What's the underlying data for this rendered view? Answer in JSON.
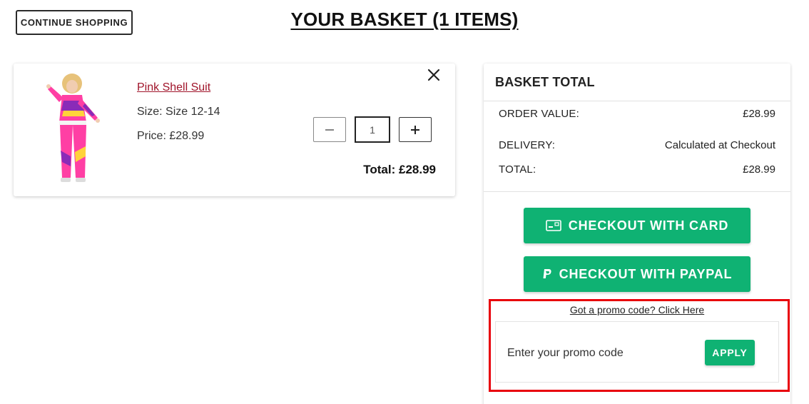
{
  "header": {
    "continue_label": "CONTINUE SHOPPING",
    "title": "YOUR BASKET (1 ITEMS)"
  },
  "item": {
    "name": "Pink Shell Suit",
    "size": "Size: Size 12-14",
    "price": "Price: £28.99",
    "quantity": "1",
    "total": "Total: £28.99",
    "image_icon": "product-photo",
    "remove_icon": "close-icon"
  },
  "summary": {
    "title": "BASKET TOTAL",
    "rows": [
      {
        "label": "ORDER VALUE:",
        "value": "£28.99"
      },
      {
        "label": "DELIVERY:",
        "value": "Calculated at Checkout"
      },
      {
        "label": "TOTAL:",
        "value": "£28.99"
      }
    ],
    "checkout_card_label": "CHECKOUT WITH CARD",
    "checkout_paypal_label": "CHECKOUT WITH PAYPAL"
  },
  "promo": {
    "link_text": "Got a promo code? Click Here",
    "placeholder": "Enter your promo code",
    "apply_label": "APPLY"
  },
  "colors": {
    "accent_green": "#0fb273",
    "link_red": "#a0142a",
    "highlight_red": "#e8000b"
  }
}
